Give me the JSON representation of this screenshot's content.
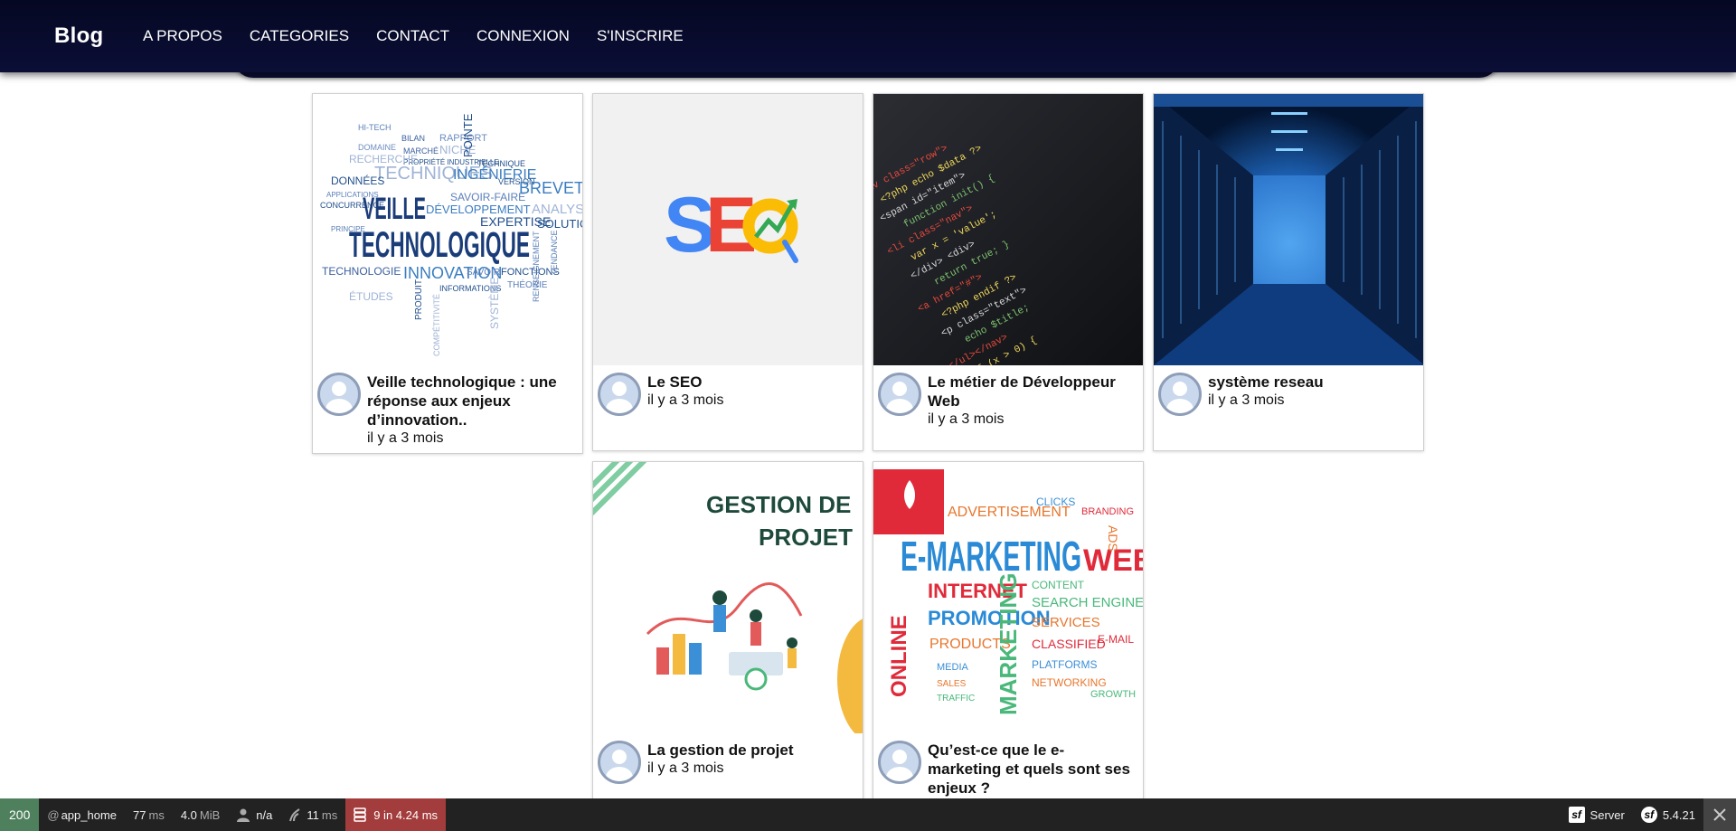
{
  "nav": {
    "brand": "Blog",
    "links": [
      "A PROPOS",
      "CATEGORIES",
      "CONTACT",
      "CONNEXION",
      "S'INSCRIRE"
    ]
  },
  "cards": [
    {
      "title": "Veille technologique : une réponse aux enjeux d’innovation..",
      "date": "il y a 3 mois",
      "image": "veille-technologique-word-cloud"
    },
    {
      "title": "Le SEO",
      "date": "il y a 3 mois",
      "image": "seo-logo"
    },
    {
      "title": "Le métier de Développeur Web",
      "date": "il y a 3 mois",
      "image": "code-screen"
    },
    {
      "title": "système reseau",
      "date": "il y a 3 mois",
      "image": "server-room"
    },
    {
      "title": "La gestion de projet",
      "date": "il y a 3 mois",
      "image": "gestion-de-projet-illustration"
    },
    {
      "title": "Qu’est-ce que le e-marketing et quels sont ses enjeux ?",
      "date": "",
      "image": "e-marketing-word-cloud"
    }
  ],
  "image_text": {
    "veille_1": "VEILLE",
    "veille_2": "TECHNOLOGIQUE",
    "seo": "SEO",
    "gestion_1": "GESTION DE",
    "gestion_2": "PROJET",
    "emarketing": "E-MARKETING"
  },
  "debug": {
    "status": "200",
    "route": "app_home",
    "time_value": "77",
    "time_unit": "ms",
    "memory_value": "4.0",
    "memory_unit": "MiB",
    "user": "n/a",
    "twig_value": "11",
    "twig_unit": "ms",
    "db": "9 in 4.24 ms",
    "server": "Server",
    "version": "5.4.21"
  },
  "colors": {
    "navbar": "#0b0e36",
    "debug_bar": "#222222",
    "status_green": "#4f805d",
    "db_red": "#a33c3c"
  }
}
